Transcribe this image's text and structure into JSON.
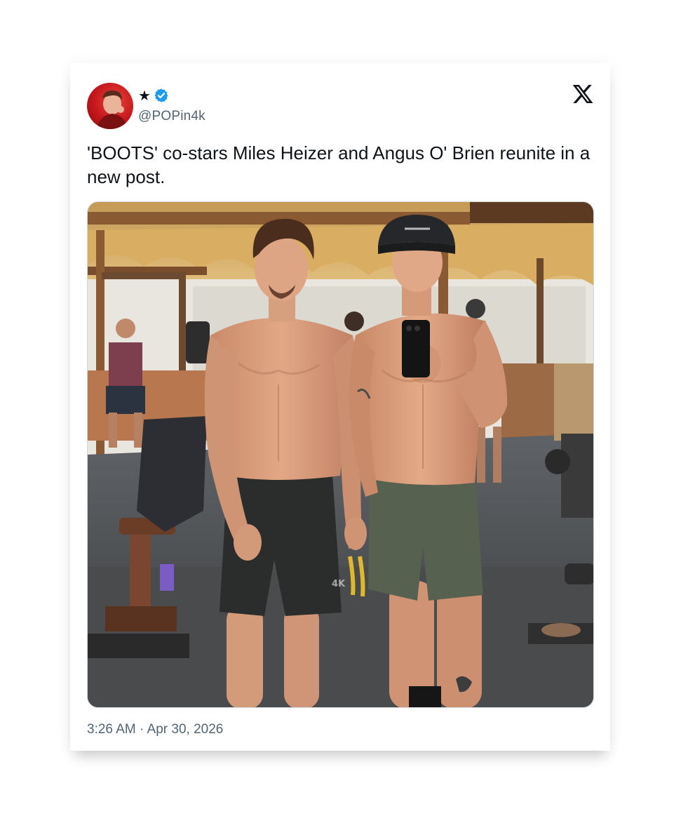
{
  "post": {
    "display_name_icon": "★",
    "verified_icon": "verified-badge-icon",
    "handle": "@POPin4k",
    "platform_icon": "x-logo-icon",
    "text": "'BOOTS' co-stars Miles Heizer and Angus O' Brien reunite in a new post.",
    "media_watermark": "4K",
    "timestamp": "3:26 AM · Apr 30, 2026"
  },
  "colors": {
    "text_primary": "#0f1419",
    "text_secondary": "#536471",
    "verified_blue": "#1d9bf0",
    "avatar_red": "#c4161c"
  }
}
